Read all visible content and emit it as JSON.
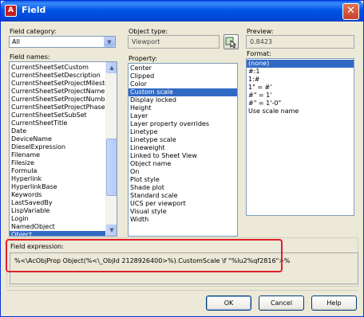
{
  "window": {
    "title": "Field",
    "app_icon": "autocad-icon",
    "close_symbol": "✕"
  },
  "field_category": {
    "label": "Field category:",
    "value": "All"
  },
  "field_names": {
    "label": "Field names:",
    "items": [
      "CurrentSheetSetCustom",
      "CurrentSheetSetDescription",
      "CurrentSheetSetProjectMilestone",
      "CurrentSheetSetProjectName",
      "CurrentSheetSetProjectNumber",
      "CurrentSheetSetProjectPhase",
      "CurrentSheetSetSubSet",
      "CurrentSheetTitle",
      "Date",
      "DeviceName",
      "DieselExpression",
      "Filename",
      "Filesize",
      "Formula",
      "Hyperlink",
      "HyperlinkBase",
      "Keywords",
      "LastSavedBy",
      "LispVariable",
      "Login",
      "NamedObject",
      "Object",
      "PageSetupName"
    ],
    "selected": "Object"
  },
  "object_type": {
    "label": "Object type:",
    "value": "Viewport",
    "pick_icon": "select-object-icon"
  },
  "property": {
    "label": "Property:",
    "items": [
      "Center",
      "Clipped",
      "Color",
      "Custom scale",
      "Display locked",
      "Height",
      "Layer",
      "Layer property overrides",
      "Linetype",
      "Linetype scale",
      "Lineweight",
      "Linked to Sheet View",
      "Object name",
      "On",
      "Plot style",
      "Shade plot",
      "Standard scale",
      "UCS per viewport",
      "Visual style",
      "Width"
    ],
    "selected": "Custom scale"
  },
  "preview": {
    "label": "Preview:",
    "value": "0.8423"
  },
  "format": {
    "label": "Format:",
    "items": [
      "(none)",
      "#:1",
      "1:#",
      "1\" = #'",
      "#\" = 1'",
      "#\" = 1'-0\"",
      "Use scale name"
    ],
    "selected": "(none)"
  },
  "field_expression": {
    "label": "Field expression:",
    "value": "%<\\AcObjProp Object(%<\\_ObjId 2128926400>%).CustomScale \\f \"%lu2%qf2816\">%"
  },
  "buttons": {
    "ok": "OK",
    "cancel": "Cancel",
    "help": "Help"
  }
}
